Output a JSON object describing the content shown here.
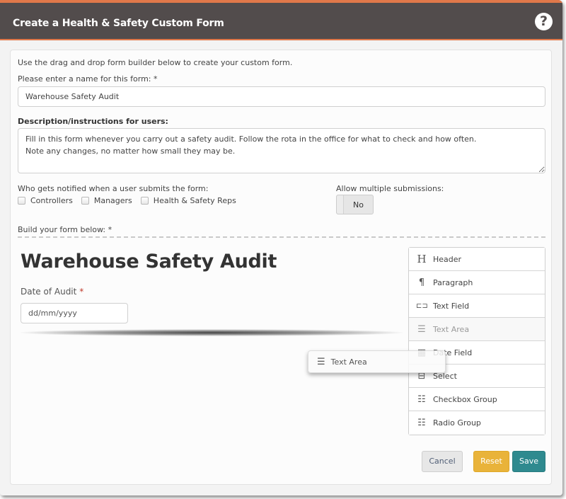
{
  "dialog": {
    "title": "Create a Health & Safety Custom Form",
    "help_icon": "?"
  },
  "form": {
    "intro": "Use the drag and drop form builder below to create your custom form.",
    "name_label": "Please enter a name for this form: *",
    "name_value": "Warehouse Safety Audit",
    "description_label": "Description/instructions for users:",
    "description_value": "Fill in this form whenever you carry out a safety audit. Follow the rota in the office for what to check and how often.\nNote any changes, no matter how small they may be.",
    "notify_label": "Who gets notified when a user submits the form:",
    "notify_options": [
      {
        "label": "Controllers",
        "checked": false
      },
      {
        "label": "Managers",
        "checked": false
      },
      {
        "label": "Health & Safety Reps",
        "checked": false
      }
    ],
    "multiple_label": "Allow multiple submissions:",
    "multiple_value": "No",
    "build_label": "Build your form below: *"
  },
  "builder": {
    "form_title": "Warehouse Safety Audit",
    "field_label": "Date of Audit",
    "field_required": "*",
    "field_placeholder": "dd/mm/yyyy",
    "palette": [
      {
        "label": "Header",
        "icon": "H"
      },
      {
        "label": "Paragraph",
        "icon": "¶"
      },
      {
        "label": "Text Field",
        "icon": "⊏⊐"
      },
      {
        "label": "Text Area",
        "icon": "☰"
      },
      {
        "label": "Date Field",
        "icon": "▦"
      },
      {
        "label": "Select",
        "icon": "⊟"
      },
      {
        "label": "Checkbox Group",
        "icon": "☷"
      },
      {
        "label": "Radio Group",
        "icon": "☷"
      }
    ],
    "dragging_item": {
      "label": "Text Area",
      "icon": "☰"
    }
  },
  "actions": {
    "cancel": "Cancel",
    "reset": "Reset",
    "save": "Save"
  }
}
